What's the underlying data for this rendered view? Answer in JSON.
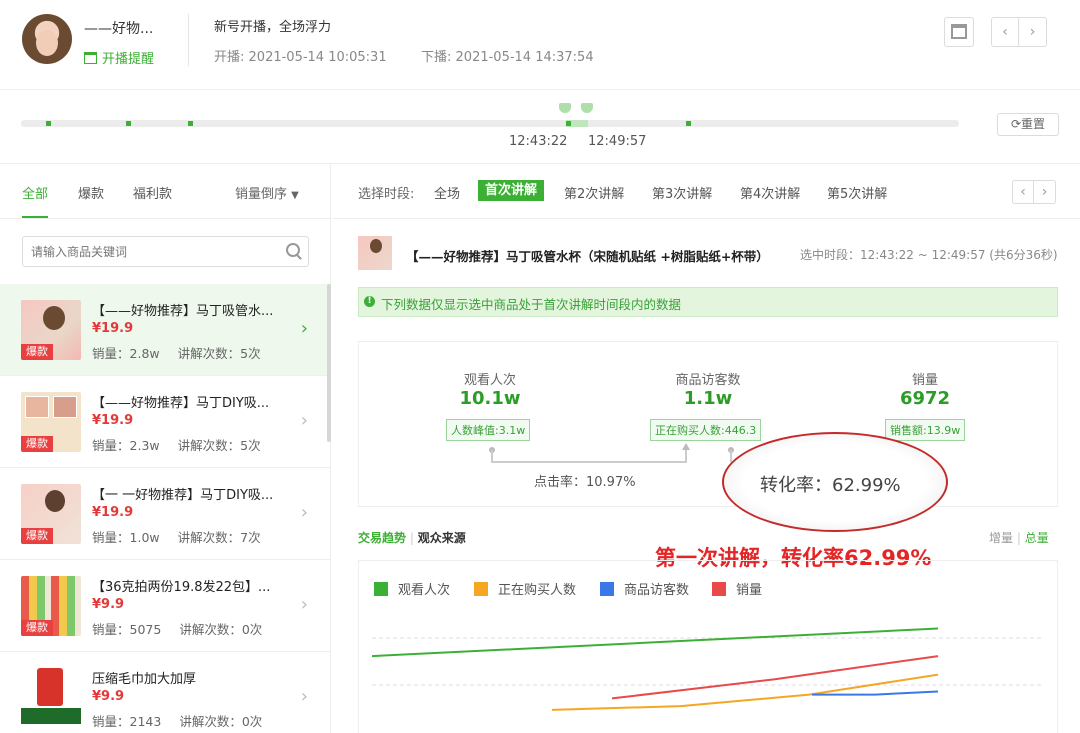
{
  "header": {
    "streamer_name": "——好物...",
    "reminder_label": "开播提醒",
    "live_title": "新号开播，全场浮力",
    "start_label": "开播:",
    "start_time": "2021-05-14 10:05:31",
    "end_label": "下播:",
    "end_time": "2021-05-14 14:37:54"
  },
  "timeline": {
    "selected_start": "12:43:22",
    "selected_end": "12:49:57",
    "reset_label": "重置"
  },
  "sidebar": {
    "tabs": [
      "全部",
      "爆款",
      "福利款"
    ],
    "active_tab": "全部",
    "sort_label": "销量倒序",
    "search_placeholder": "请输入商品关键词",
    "sales_label": "销量：",
    "explain_label": "讲解次数：",
    "items": [
      {
        "name": "【——好物推荐】马丁吸管水...",
        "price": "¥19.9",
        "sales": "2.8w",
        "explains": "5次",
        "badge": "爆款"
      },
      {
        "name": "【——好物推荐】马丁DIY吸...",
        "price": "¥19.9",
        "sales": "2.3w",
        "explains": "5次",
        "badge": "爆款"
      },
      {
        "name": "【一 一好物推荐】马丁DIY吸...",
        "price": "¥19.9",
        "sales": "1.0w",
        "explains": "7次",
        "badge": "爆款"
      },
      {
        "name": "【36克拍两份19.8发22包】...",
        "price": "¥9.9",
        "sales": "5075",
        "explains": "0次",
        "badge": "爆款"
      },
      {
        "name": "压缩毛巾加大加厚",
        "price": "¥9.9",
        "sales": "2143",
        "explains": "0次",
        "badge": ""
      }
    ]
  },
  "period": {
    "label": "选择时段:",
    "options": [
      "全场",
      "首次讲解",
      "第2次讲解",
      "第3次讲解",
      "第4次讲解",
      "第5次讲解"
    ],
    "active": "首次讲解"
  },
  "product": {
    "title": "【——好物推荐】马丁吸管水杯（宋随机贴纸 +树脂贴纸+杯带）",
    "range": "选中时段：12:43:22 ~ 12:49:57 (共6分36秒)"
  },
  "notice": "下列数据仅显示选中商品处于首次讲解时间段内的数据",
  "metrics": {
    "views_label": "观看人次",
    "views_value": "10.1w",
    "views_tag": "人数峰值:3.1w",
    "visitors_label": "商品访客数",
    "visitors_value": "1.1w",
    "visitors_tag": "正在购买人数:446.3",
    "sales_label": "销量",
    "sales_value": "6972",
    "sales_tag": "销售额:13.9w",
    "ctr": "点击率：10.97%",
    "conversion": "转化率：62.99%"
  },
  "annotation": "第一次讲解，转化率62.99%",
  "trend": {
    "tab_trade": "交易趋势",
    "tab_source": "观众来源",
    "toggle_inc": "增量",
    "toggle_total": "总量"
  },
  "colors": {
    "accent": "#3cb034",
    "price": "#e23a3a",
    "series_views": "#3cb034",
    "series_buying": "#f5a623",
    "series_visitors": "#3a78e8",
    "series_sales": "#e84a4a"
  },
  "chart_data": {
    "type": "line",
    "legend": [
      "观看人次",
      "正在购买人数",
      "商品访客数",
      "销量"
    ],
    "series": [
      {
        "name": "观看人次",
        "values": [
          10,
          28,
          46
        ]
      },
      {
        "name": "正在购买人数",
        "values": [
          -60,
          -55,
          -40,
          -14
        ]
      },
      {
        "name": "商品访客数",
        "values": [
          -40,
          -40,
          -36
        ]
      },
      {
        "name": "销量",
        "values": [
          -45,
          -20,
          10
        ]
      }
    ],
    "grid": true,
    "legend_position": "top-left"
  }
}
